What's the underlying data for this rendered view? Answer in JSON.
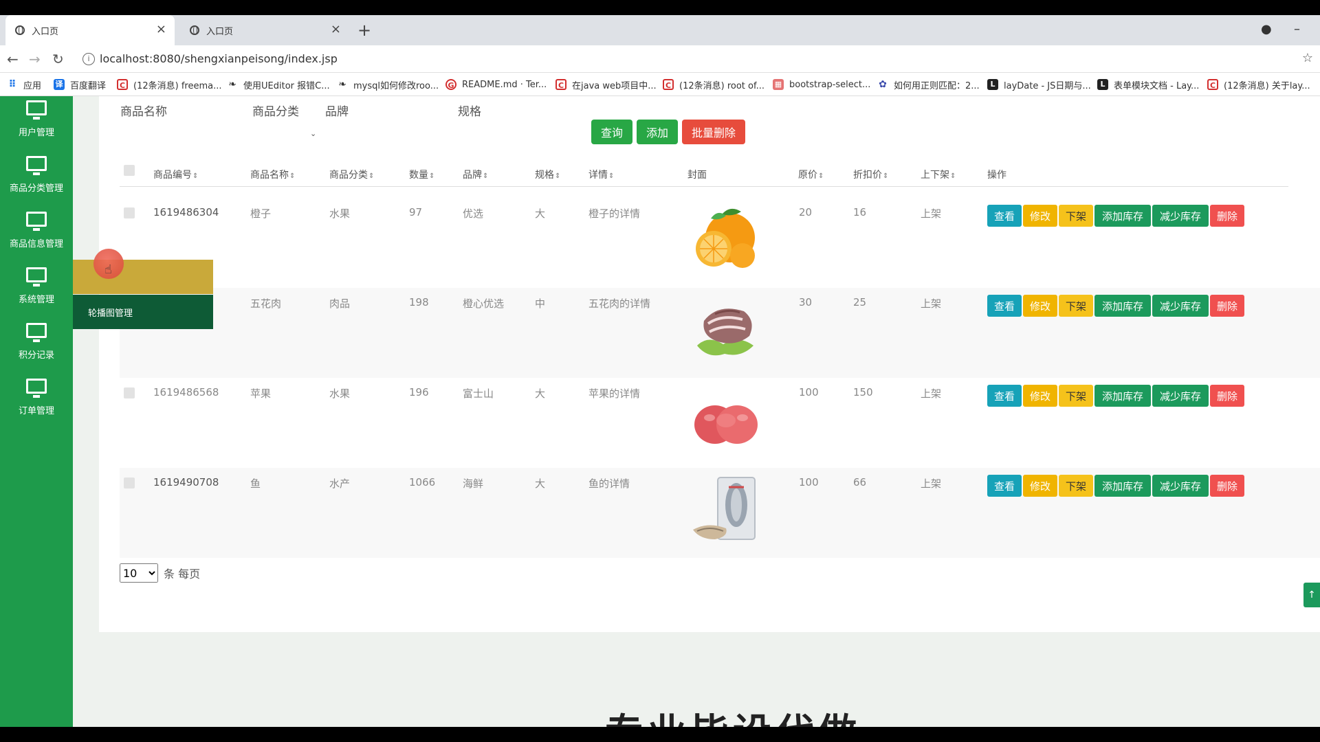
{
  "browser": {
    "tabs": [
      {
        "title": "入口页",
        "active": true
      },
      {
        "title": "入口页",
        "active": false
      }
    ],
    "url": "localhost:8080/shengxianpeisong/index.jsp",
    "bookmarks": [
      {
        "label": "应用",
        "icon": "apps-grid-icon"
      },
      {
        "label": "百度翻译",
        "icon": "baidu-translate-icon"
      },
      {
        "label": "(12条消息) freema...",
        "icon": "csdn-icon"
      },
      {
        "label": "使用UEditor 报错C...",
        "icon": "leaf-icon"
      },
      {
        "label": "mysql如何修改roo...",
        "icon": "leaf-icon"
      },
      {
        "label": "README.md · Ter...",
        "icon": "gitee-icon"
      },
      {
        "label": "在java web项目中...",
        "icon": "csdn-icon"
      },
      {
        "label": "(12条消息) root of...",
        "icon": "csdn-icon"
      },
      {
        "label": "bootstrap-select...",
        "icon": "bookmark-icon"
      },
      {
        "label": "如何用正则匹配：2...",
        "icon": "baidu-paw-icon"
      },
      {
        "label": "layDate - JS日期与...",
        "icon": "layui-icon"
      },
      {
        "label": "表单模块文档 - Lay...",
        "icon": "layui-icon"
      },
      {
        "label": "(12条消息) 关于lay...",
        "icon": "csdn-icon"
      }
    ]
  },
  "sidebar": {
    "items": [
      {
        "label": "用户管理"
      },
      {
        "label": "商品分类管理"
      },
      {
        "label": "商品信息管理"
      },
      {
        "label": "系统管理"
      },
      {
        "label": "积分记录"
      },
      {
        "label": "订单管理"
      }
    ],
    "submenu": {
      "items": [
        {
          "label": ""
        },
        {
          "label": "轮播图管理"
        }
      ]
    }
  },
  "filters": {
    "product_name_label": "商品名称",
    "category_label": "商品分类",
    "brand_label": "品牌",
    "spec_label": "规格"
  },
  "toolbar": {
    "query_label": "查询",
    "add_label": "添加",
    "batch_delete_label": "批量删除"
  },
  "table": {
    "columns": [
      "商品编号",
      "商品名称",
      "商品分类",
      "数量",
      "品牌",
      "规格",
      "详情",
      "封面",
      "原价",
      "折扣价",
      "上下架",
      "操作"
    ],
    "rows": [
      {
        "id": "1619486304",
        "name": "橙子",
        "category": "水果",
        "qty": "97",
        "brand": "优选",
        "spec": "大",
        "detail": "橙子的详情",
        "cover": "orange",
        "price": "20",
        "discount": "16",
        "status": "上架"
      },
      {
        "id": "",
        "name": "五花肉",
        "category": "肉品",
        "qty": "198",
        "brand": "橙心优选",
        "spec": "中",
        "detail": "五花肉的详情",
        "cover": "pork",
        "price": "30",
        "discount": "25",
        "status": "上架"
      },
      {
        "id": "1619486568",
        "name": "苹果",
        "category": "水果",
        "qty": "196",
        "brand": "富士山",
        "spec": "大",
        "detail": "苹果的详情",
        "cover": "apple",
        "price": "100",
        "discount": "150",
        "status": "上架"
      },
      {
        "id": "1619490708",
        "name": "鱼",
        "category": "水产",
        "qty": "1066",
        "brand": "海鲜",
        "spec": "大",
        "detail": "鱼的详情",
        "cover": "fish",
        "price": "100",
        "discount": "66",
        "status": "上架"
      }
    ],
    "actions": {
      "view": "查看",
      "edit": "修改",
      "unlist": "下架",
      "add_stock": "添加库存",
      "reduce_stock": "减少库存",
      "delete": "删除"
    }
  },
  "pagination": {
    "page_size": "10",
    "suffix": "条 每页"
  },
  "footer": {
    "big_text": "专业毕设代做"
  },
  "colors": {
    "sidebar": "#1e9b4b",
    "submenu_hover": "#c9a93a",
    "submenu": "#0e5b36",
    "view": "#17a2b8",
    "edit": "#f0b400",
    "stock": "#1c9a5c",
    "delete": "#f0504f"
  }
}
